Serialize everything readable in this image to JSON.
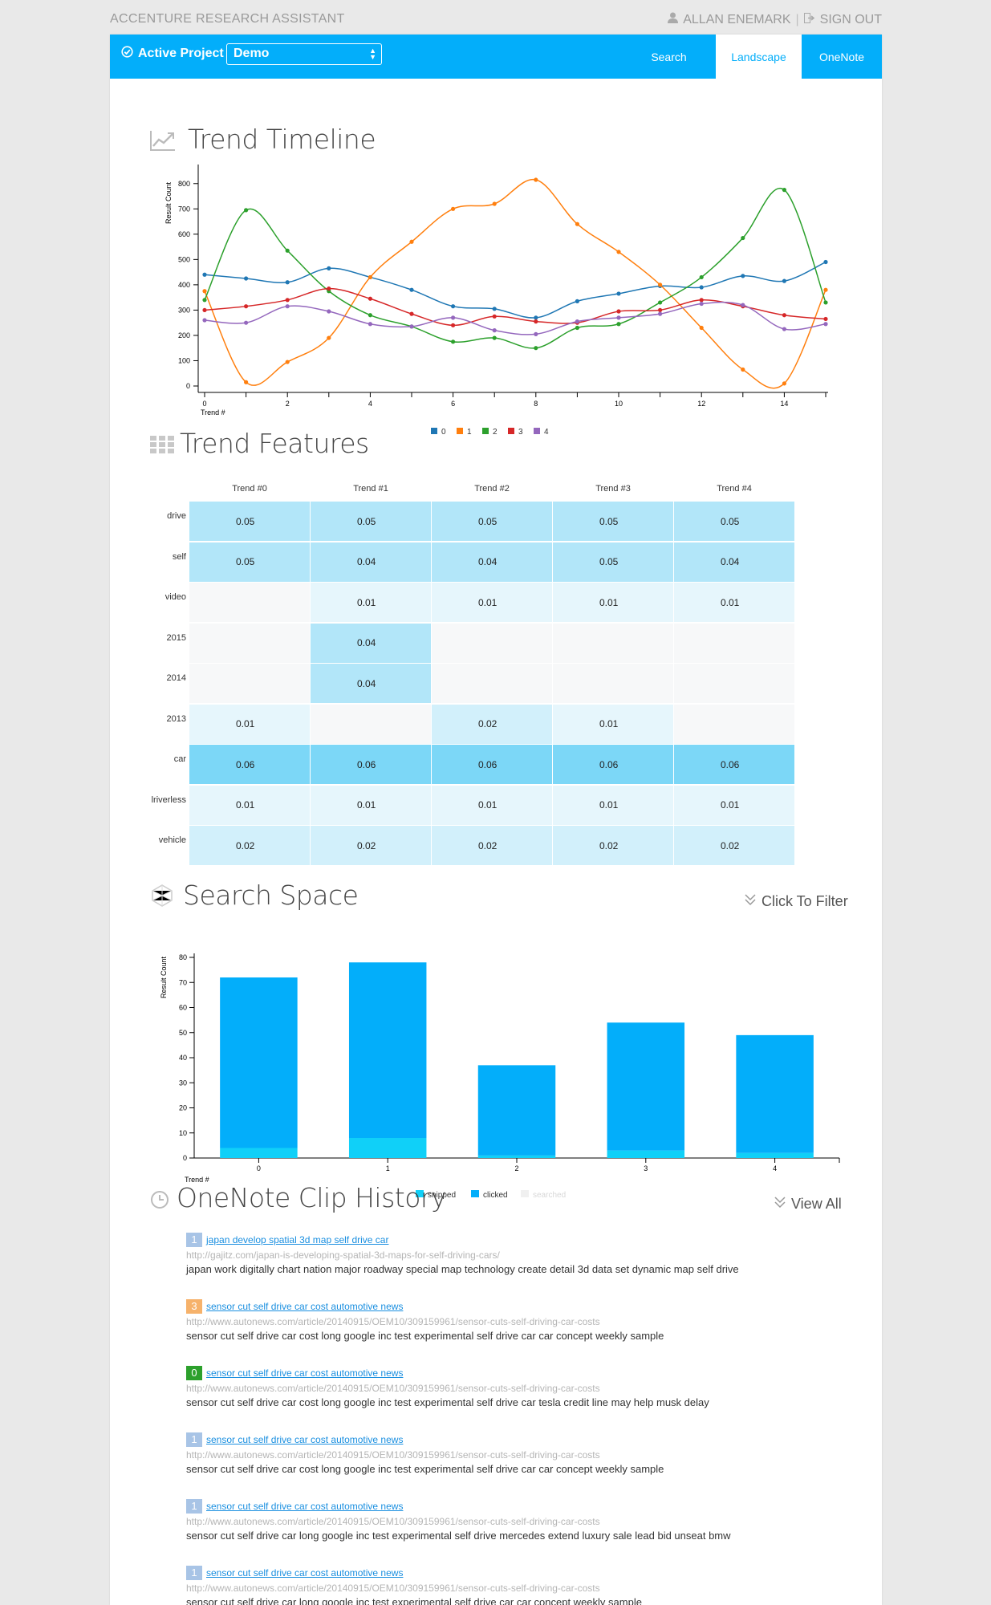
{
  "header": {
    "brand": "ACCENTURE RESEARCH ASSISTANT",
    "user": "ALLAN ENEMARK",
    "divider": "|",
    "sign_out": "SIGN OUT"
  },
  "navbar": {
    "active_project_label": "Active Project",
    "project_value": "Demo",
    "tabs": [
      {
        "label": "Search",
        "active": false
      },
      {
        "label": "Landscape",
        "active": true
      },
      {
        "label": "OneNote",
        "active": false
      }
    ],
    "accent_color": "#03aefa"
  },
  "trend_timeline": {
    "title": "Trend Timeline",
    "icon": "line-chart-icon",
    "chart_data": {
      "type": "line",
      "ylabel": "Result Count",
      "xlabel": "Trend #",
      "x": [
        0,
        1,
        2,
        3,
        4,
        5,
        6,
        7,
        8,
        9,
        10,
        11,
        12,
        13,
        14,
        15
      ],
      "xticks": [
        0,
        2,
        4,
        6,
        8,
        10,
        12,
        14
      ],
      "yticks": [
        0,
        100,
        200,
        300,
        400,
        500,
        600,
        700,
        800
      ],
      "ylim": [
        0,
        850
      ],
      "xlim": [
        0,
        15
      ],
      "legend_position": "bottom-center",
      "series": [
        {
          "name": "0",
          "color": "#1f77b4",
          "values": [
            440,
            425,
            410,
            465,
            430,
            380,
            315,
            305,
            270,
            335,
            365,
            395,
            390,
            435,
            415,
            490
          ]
        },
        {
          "name": "1",
          "color": "#ff7f0e",
          "values": [
            375,
            15,
            95,
            190,
            430,
            570,
            700,
            720,
            815,
            640,
            530,
            400,
            230,
            65,
            10,
            380
          ]
        },
        {
          "name": "2",
          "color": "#2ca02c",
          "values": [
            340,
            695,
            535,
            375,
            280,
            235,
            175,
            190,
            150,
            230,
            245,
            330,
            430,
            585,
            775,
            330
          ]
        },
        {
          "name": "3",
          "color": "#d62728",
          "values": [
            300,
            315,
            340,
            385,
            345,
            285,
            240,
            275,
            255,
            250,
            295,
            300,
            340,
            315,
            280,
            265
          ]
        },
        {
          "name": "4",
          "color": "#9467bd",
          "values": [
            260,
            250,
            315,
            295,
            245,
            235,
            270,
            220,
            205,
            255,
            270,
            285,
            325,
            320,
            225,
            245
          ]
        }
      ]
    }
  },
  "trend_features": {
    "title": "Trend Features",
    "icon": "grid-icon",
    "chart_data": {
      "type": "heatmap",
      "columns": [
        "Trend #0",
        "Trend #1",
        "Trend #2",
        "Trend #3",
        "Trend #4"
      ],
      "rows": [
        "drive",
        "self",
        "video",
        "2015",
        "2014",
        "2013",
        "car",
        "lriverless",
        "vehicle"
      ],
      "values": [
        [
          "0.05",
          "0.05",
          "0.05",
          "0.05",
          "0.05"
        ],
        [
          "0.05",
          "0.04",
          "0.04",
          "0.05",
          "0.04"
        ],
        [
          "",
          "0.01",
          "0.01",
          "0.01",
          "0.01"
        ],
        [
          "",
          "0.04",
          "",
          "",
          ""
        ],
        [
          "",
          "0.04",
          "",
          "",
          ""
        ],
        [
          "0.01",
          "",
          "0.02",
          "0.01",
          ""
        ],
        [
          "0.06",
          "0.06",
          "0.06",
          "0.06",
          "0.06"
        ],
        [
          "0.01",
          "0.01",
          "0.01",
          "0.01",
          "0.01"
        ],
        [
          "0.02",
          "0.02",
          "0.02",
          "0.02",
          "0.02"
        ]
      ]
    }
  },
  "search_space": {
    "title": "Search Space",
    "icon": "hexagon-icon",
    "filter_label": "Click To Filter",
    "chart_data": {
      "type": "bar",
      "ylabel": "Result Count",
      "xlabel": "Trend #",
      "categories": [
        "0",
        "1",
        "2",
        "3",
        "4"
      ],
      "ylim": [
        0,
        80
      ],
      "yticks": [
        0,
        10,
        20,
        30,
        40,
        50,
        60,
        70,
        80
      ],
      "stacked": true,
      "legend_position": "bottom-center",
      "series": [
        {
          "name": "snipped",
          "color": "#10d0f8",
          "values": [
            4,
            8,
            1,
            3,
            2
          ]
        },
        {
          "name": "clicked",
          "color": "#03aefa",
          "values": [
            68,
            70,
            36,
            51,
            47
          ]
        },
        {
          "name": "searched",
          "color": "#f0f0f0",
          "values": [
            0,
            0,
            0,
            0,
            0
          ]
        }
      ]
    }
  },
  "clip_history": {
    "title": "OneNote Clip History",
    "icon": "clock-icon",
    "view_all_label": "View All",
    "items": [
      {
        "badge": "1",
        "badge_color": "#a8c4e6",
        "title": "japan develop spatial 3d map self drive car",
        "url": "http://gajitz.com/japan-is-developing-spatial-3d-maps-for-self-driving-cars/",
        "desc": "japan work digitally chart nation major roadway special map technology create detail 3d data set dynamic map self drive"
      },
      {
        "badge": "3",
        "badge_color": "#f6b26b",
        "title": "sensor cut self drive car cost automotive news",
        "url": "http://www.autonews.com/article/20140915/OEM10/309159961/sensor-cuts-self-driving-car-costs",
        "desc": "sensor cut self drive car cost long google inc test experimental self drive car car concept weekly sample"
      },
      {
        "badge": "0",
        "badge_color": "#2ca02c",
        "title": "sensor cut self drive car cost automotive news",
        "url": "http://www.autonews.com/article/20140915/OEM10/309159961/sensor-cuts-self-driving-car-costs",
        "desc": "sensor cut self drive car cost long google inc test experimental self drive car tesla credit line may help musk delay"
      },
      {
        "badge": "1",
        "badge_color": "#a8c4e6",
        "title": "sensor cut self drive car cost automotive news",
        "url": "http://www.autonews.com/article/20140915/OEM10/309159961/sensor-cuts-self-driving-car-costs",
        "desc": "sensor cut self drive car cost long google inc test experimental self drive car car concept weekly sample"
      },
      {
        "badge": "1",
        "badge_color": "#a8c4e6",
        "title": "sensor cut self drive car cost automotive news",
        "url": "http://www.autonews.com/article/20140915/OEM10/309159961/sensor-cuts-self-driving-car-costs",
        "desc": "sensor cut self drive car long google inc test experimental self drive mercedes extend luxury sale lead bid unseat bmw"
      },
      {
        "badge": "1",
        "badge_color": "#a8c4e6",
        "title": "sensor cut self drive car cost automotive news",
        "url": "http://www.autonews.com/article/20140915/OEM10/309159961/sensor-cuts-self-driving-car-costs",
        "desc": "sensor cut self drive car long google inc test experimental self drive car car concept weekly sample"
      }
    ]
  }
}
